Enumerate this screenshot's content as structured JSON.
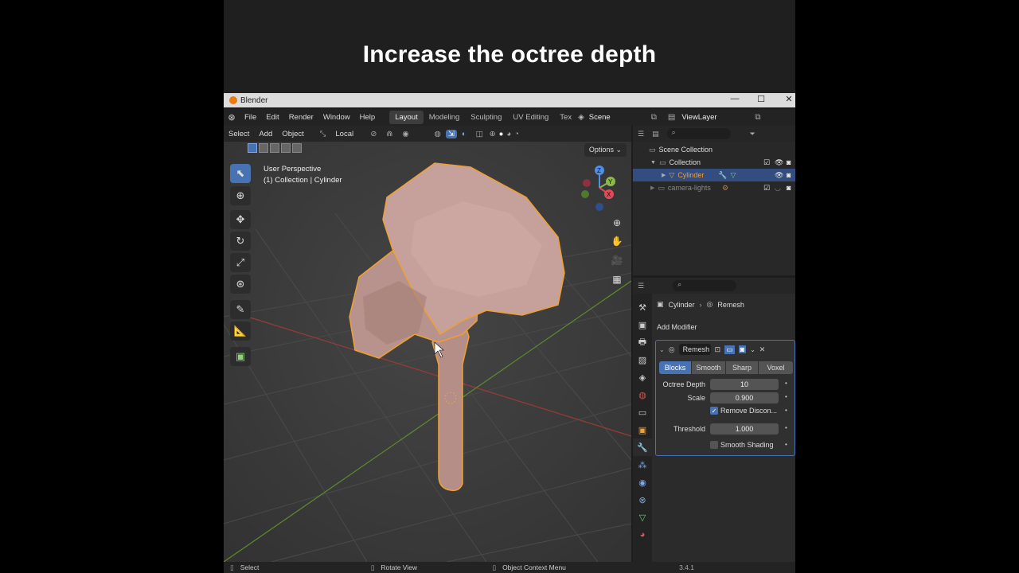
{
  "banner": {
    "caption": "Increase the octree depth"
  },
  "window": {
    "title": "Blender",
    "minimize": "—",
    "maximize": "☐",
    "close": "✕"
  },
  "menubar": {
    "menus": [
      "File",
      "Edit",
      "Render",
      "Window",
      "Help"
    ],
    "workspaces": [
      "Layout",
      "Modeling",
      "Sculpting",
      "UV Editing",
      "Tex"
    ],
    "active_workspace": "Layout",
    "scene": "Scene",
    "view_layer": "ViewLayer"
  },
  "viewport": {
    "header": {
      "select": "Select",
      "add": "Add",
      "object": "Object",
      "transform_orientation": "Local"
    },
    "options": "Options",
    "info_line1": "User Perspective",
    "info_line2": "(1) Collection | Cylinder",
    "gizmo": {
      "z": "Z",
      "y": "Y",
      "x": "X"
    }
  },
  "outliner": {
    "rows": [
      {
        "label": "Scene Collection"
      },
      {
        "label": "Collection"
      },
      {
        "label": "Cylinder"
      },
      {
        "label": "camera-lights"
      }
    ]
  },
  "properties": {
    "breadcrumb_object": "Cylinder",
    "breadcrumb_modifier": "Remesh",
    "add_modifier": "Add Modifier",
    "modifier_name": "Remesh",
    "modes": [
      "Blocks",
      "Smooth",
      "Sharp",
      "Voxel"
    ],
    "active_mode": "Blocks",
    "octree_depth_label": "Octree Depth",
    "octree_depth": "10",
    "scale_label": "Scale",
    "scale": "0.900",
    "remove_disconnected": "Remove Discon...",
    "threshold_label": "Threshold",
    "threshold": "1.000",
    "smooth_shading": "Smooth Shading"
  },
  "statusbar": {
    "select": "Select",
    "rotate": "Rotate View",
    "context": "Object Context Menu",
    "version": "3.4.1"
  },
  "colors": {
    "accent": "#4772b3",
    "mesh": "#c9a09a",
    "outline": "#f0a030"
  }
}
